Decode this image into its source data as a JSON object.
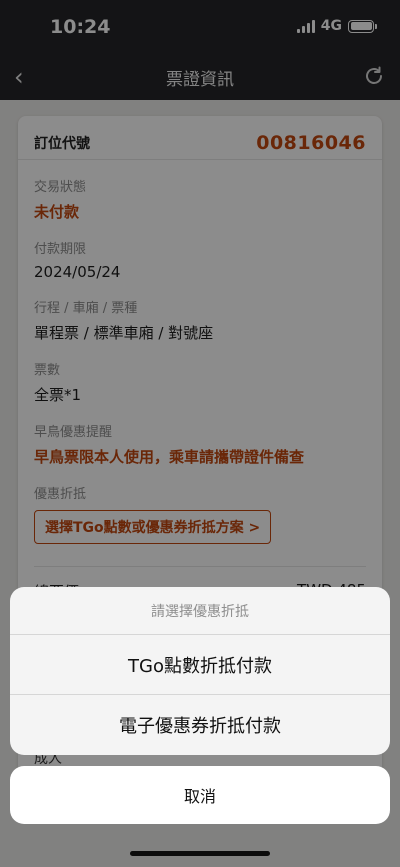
{
  "status_bar": {
    "time": "10:24",
    "network": "4G"
  },
  "nav": {
    "title": "票證資訊",
    "back_icon": "chevron-left-icon",
    "refresh_icon": "refresh-icon"
  },
  "order": {
    "booking_label": "訂位代號",
    "booking_code": "00816046",
    "fields": [
      {
        "label": "交易狀態",
        "value": "未付款"
      },
      {
        "label": "付款期限",
        "value": "2024/05/24"
      },
      {
        "label": "行程 / 車廂 / 票種",
        "value": "單程票 / 標準車廂 / 對號座"
      },
      {
        "label": "票數",
        "value": "全票*1"
      },
      {
        "label": "早鳥優惠提醒",
        "value": "早鳥票限本人使用，乘車請攜帶證件備查"
      },
      {
        "label": "優惠折抵",
        "value": "選擇TGo點數或優惠券折抵方案 >"
      }
    ],
    "total_label": "總票價",
    "total_value": "TWD 485",
    "peek_text": "成人"
  },
  "action_sheet": {
    "title": "請選擇優惠折抵",
    "options": [
      "TGo點數折抵付款",
      "電子優惠券折抵付款"
    ],
    "cancel": "取消"
  },
  "colors": {
    "accent": "#c2470f",
    "navbar": "#252629"
  }
}
